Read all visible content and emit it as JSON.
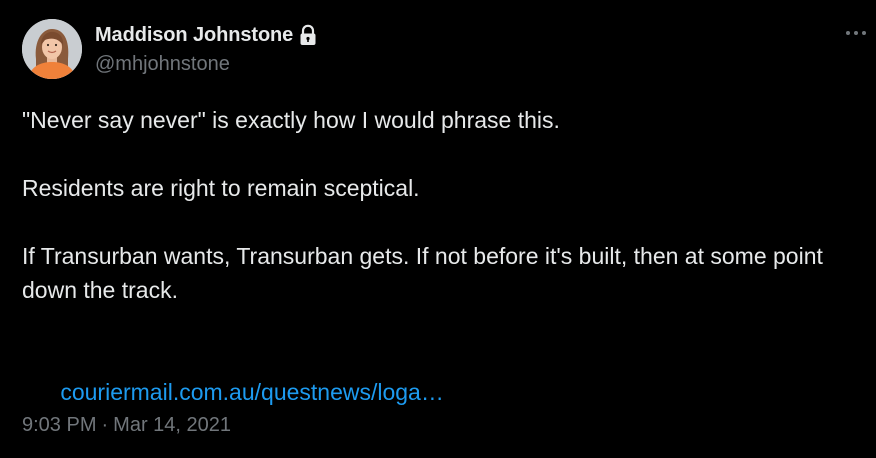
{
  "author": {
    "display_name": "Maddison Johnstone",
    "handle": "@mhjohnstone",
    "avatar_icon": "profile-photo",
    "lock_icon": "lock-icon"
  },
  "tweet": {
    "paragraphs": [
      "\"Never say never\" is exactly how I would phrase this.",
      "Residents are right to remain sceptical.",
      "If Transurban wants, Transurban gets. If not before it's built, then at some point down the track."
    ],
    "link_text": "couriermail.com.au/questnews/loga…"
  },
  "meta": {
    "time": "9:03 PM",
    "separator": "·",
    "date": "Mar 14, 2021"
  },
  "menu": {
    "icon": "more-horizontal-icon"
  },
  "colors": {
    "background": "#000000",
    "text_primary": "#e7e9ea",
    "text_secondary": "#71767b",
    "link": "#1d9bf0",
    "avatar_shirt": "#f0813a"
  }
}
